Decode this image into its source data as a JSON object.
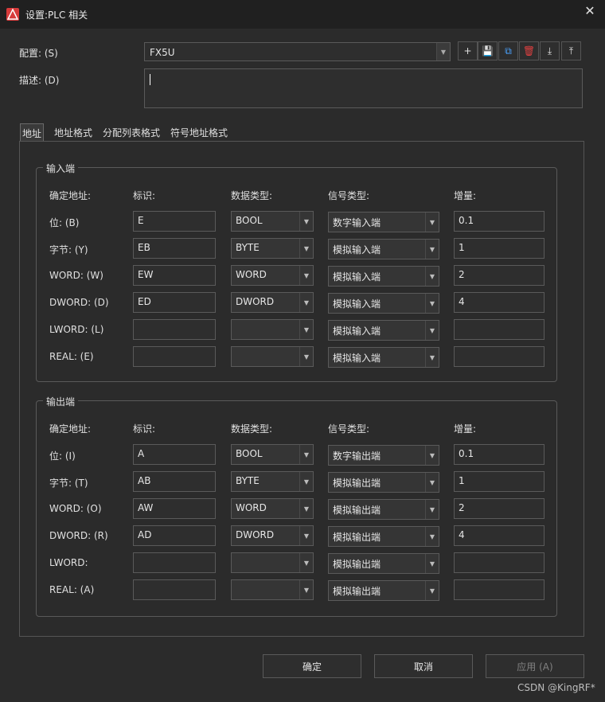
{
  "window": {
    "title": "设置:PLC 相关",
    "close": "✕"
  },
  "config": {
    "label": "配置: (S)",
    "value": "FX5U"
  },
  "desc": {
    "label": "描述: (D)",
    "value": ""
  },
  "toolbar": [
    "+",
    "💾",
    "⧉",
    "🗑",
    "⤓",
    "⤒"
  ],
  "tabs": [
    "地址",
    "地址格式",
    "分配列表格式",
    "符号地址格式"
  ],
  "headers": [
    "确定地址:",
    "标识:",
    "数据类型:",
    "信号类型:",
    "增量:"
  ],
  "input": {
    "title": "输入端",
    "rows": [
      {
        "label": "位: (B)",
        "id": "E",
        "dtype": "BOOL",
        "signal": "数字输入端",
        "inc": "0.1"
      },
      {
        "label": "字节: (Y)",
        "id": "EB",
        "dtype": "BYTE",
        "signal": "模拟输入端",
        "inc": "1"
      },
      {
        "label": "WORD: (W)",
        "id": "EW",
        "dtype": "WORD",
        "signal": "模拟输入端",
        "inc": "2"
      },
      {
        "label": "DWORD: (D)",
        "id": "ED",
        "dtype": "DWORD",
        "signal": "模拟输入端",
        "inc": "4"
      },
      {
        "label": "LWORD: (L)",
        "id": "",
        "dtype": "",
        "signal": "模拟输入端",
        "inc": ""
      },
      {
        "label": "REAL: (E)",
        "id": "",
        "dtype": "",
        "signal": "模拟输入端",
        "inc": ""
      }
    ]
  },
  "output": {
    "title": "输出端",
    "rows": [
      {
        "label": "位: (I)",
        "id": "A",
        "dtype": "BOOL",
        "signal": "数字输出端",
        "inc": "0.1"
      },
      {
        "label": "字节: (T)",
        "id": "AB",
        "dtype": "BYTE",
        "signal": "模拟输出端",
        "inc": "1"
      },
      {
        "label": "WORD: (O)",
        "id": "AW",
        "dtype": "WORD",
        "signal": "模拟输出端",
        "inc": "2"
      },
      {
        "label": "DWORD: (R)",
        "id": "AD",
        "dtype": "DWORD",
        "signal": "模拟输出端",
        "inc": "4"
      },
      {
        "label": "LWORD:",
        "id": "",
        "dtype": "",
        "signal": "模拟输出端",
        "inc": ""
      },
      {
        "label": "REAL: (A)",
        "id": "",
        "dtype": "",
        "signal": "模拟输出端",
        "inc": ""
      }
    ]
  },
  "buttons": {
    "ok": "确定",
    "cancel": "取消",
    "apply": "应用 (A)"
  },
  "watermark": "CSDN @KingRF*"
}
